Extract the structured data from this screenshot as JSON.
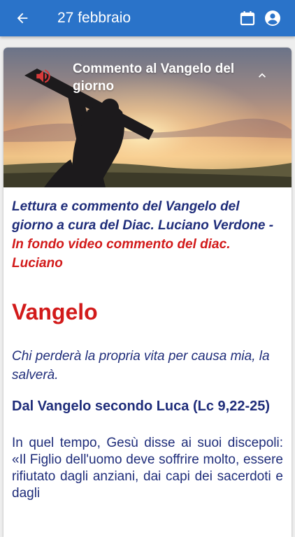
{
  "appbar": {
    "title": "27 febbraio",
    "icons": [
      "arrow-left-icon",
      "calendar-icon",
      "account-circle-icon"
    ],
    "color": "#2a73c9"
  },
  "card": {
    "hero_title": "Commento al Vangelo del giorno",
    "hero_icons": [
      "speaker-icon",
      "chevron-up-icon"
    ]
  },
  "content": {
    "intro_main": "Lettura e commento del Vangelo del giorno a cura del Diac. Luciano Verdone - ",
    "intro_red": "In fondo video commento del diac. Luciano",
    "heading": "Vangelo",
    "subtitle": "Chi perderà la propria vita per causa mia, la salverà.",
    "reference": "Dal Vangelo secondo Luca (Lc 9,22-25)",
    "body": "In quel tempo, Gesù disse ai suoi discepoli: «Il Figlio dell'uomo deve soffrire molto, essere rifiutato dagli anziani, dai capi dei sacerdoti e dagli"
  },
  "colors": {
    "accent_red": "#d21a1a",
    "text_navy": "#1f2d7a"
  }
}
